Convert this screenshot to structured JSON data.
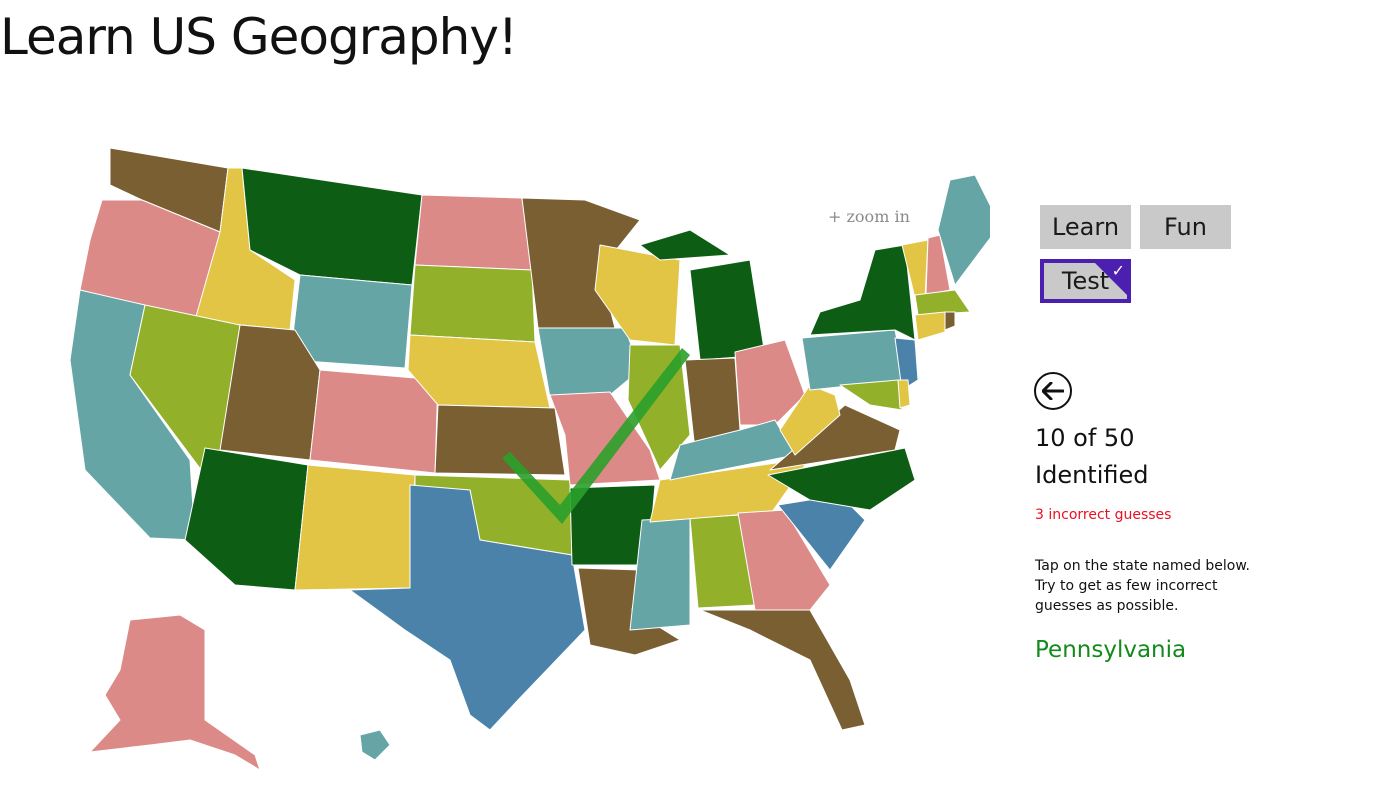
{
  "app": {
    "title": "Learn US Geography!"
  },
  "map": {
    "zoom_hint": "+ zoom in"
  },
  "modes": {
    "learn": "Learn",
    "fun": "Fun",
    "test": "Test",
    "selected": "Test"
  },
  "quiz": {
    "identified_count": "10 of 50",
    "identified_label": "Identified",
    "incorrect": "3 incorrect guesses",
    "instructions": "Tap on the state named below. Try to get as few incorrect guesses as possible.",
    "target_state": "Pennsylvania"
  },
  "icons": {
    "back": "back-arrow-icon",
    "selected_check": "checkmark-icon",
    "correct": "correct-checkmark-icon"
  },
  "colors": {
    "accent": "#4b1fb0",
    "incorrect": "#e81123",
    "target": "#138a1c",
    "state_green": "#0d5e14",
    "state_olive": "#93b02a",
    "state_brown": "#7a5f33",
    "state_pink": "#dc8a87",
    "state_yellow": "#e2c545",
    "state_teal": "#66a5a6",
    "state_blue": "#4a82a9",
    "check": "#2aa02a"
  }
}
